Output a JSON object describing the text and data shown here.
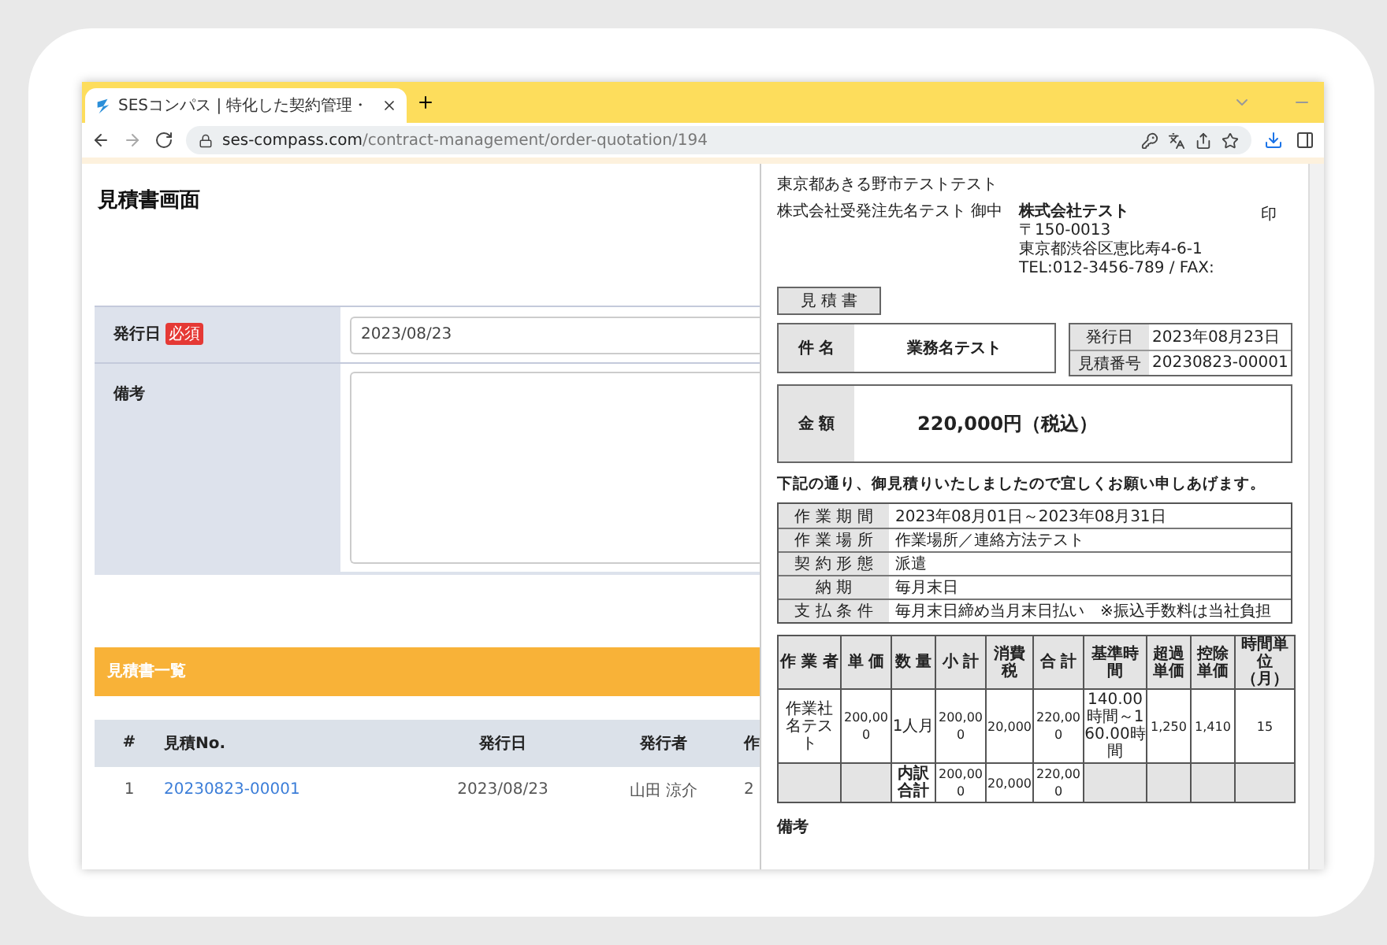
{
  "browser": {
    "tabs": [
      {
        "title": "SESコンパス | 特化した契約管理・",
        "selected": true
      }
    ],
    "url_host": "ses-compass.com",
    "url_path": "/contract-management/order-quotation/194"
  },
  "page": {
    "title": "見積書画面",
    "form": [
      {
        "kind": "input",
        "label": "発行日",
        "badge": "必須",
        "value": "2023/08/23"
      },
      {
        "kind": "textarea",
        "label": "備考"
      }
    ],
    "list_title": "見積書一覧",
    "table": {
      "columns": [
        "#",
        "見積No.",
        "発行日",
        "発行者",
        "作"
      ],
      "rows": [
        [
          "1",
          "20230823-00001",
          "2023/08/23",
          "山田 涼介",
          "2"
        ]
      ]
    }
  },
  "document": {
    "address": "東京都あきる野市テストテスト",
    "recipient": "株式会社受発注先名テスト 御中",
    "issuer": [
      "株式会社テスト",
      "〒150-0013",
      "東京都渋谷区恵比寿4-6-1",
      "TEL:012-3456-789 / FAX:"
    ],
    "seal": "印",
    "doc_title": "見 積 書",
    "subject_label": "件 名",
    "subject": "業務名テスト",
    "meta": [
      {
        "label": "発行日",
        "value": "2023年08月23日"
      },
      {
        "label": "見積番号",
        "value": "20230823-00001"
      }
    ],
    "amount_label": "金 額",
    "amount": "220,000円（税込）",
    "note": "下記の通り、御見積りいたしましたので宜しくお願い申しあげます。",
    "terms": [
      {
        "label": "作 業 期 間",
        "value": "2023年08月01日～2023年08月31日"
      },
      {
        "label": "作 業 場 所",
        "value": "作業場所／連絡方法テスト"
      },
      {
        "label": "契 約 形 態",
        "value": "派遣"
      },
      {
        "label": "納 期",
        "value": "毎月末日"
      },
      {
        "label": "支 払 条 件",
        "value": "毎月末日締め当月末日払い　※振込手数料は当社負担"
      }
    ],
    "detail_columns": [
      "作 業 者",
      "単 価",
      "数 量",
      "小 計",
      "消費税",
      "合 計",
      "基準時間",
      "超過単価",
      "控除単価",
      "時間単位（月）"
    ],
    "detail_rows": [
      [
        "作業社名テスト",
        "200,000",
        "1人月",
        "200,000",
        "20,000",
        "220,000",
        "140.00時間～160.00時間",
        "1,250",
        "1,410",
        "15"
      ]
    ],
    "totals": {
      "label": "内訳合計",
      "values": [
        "200,000",
        "20,000",
        "220,000"
      ]
    },
    "remarks_label": "備考"
  }
}
